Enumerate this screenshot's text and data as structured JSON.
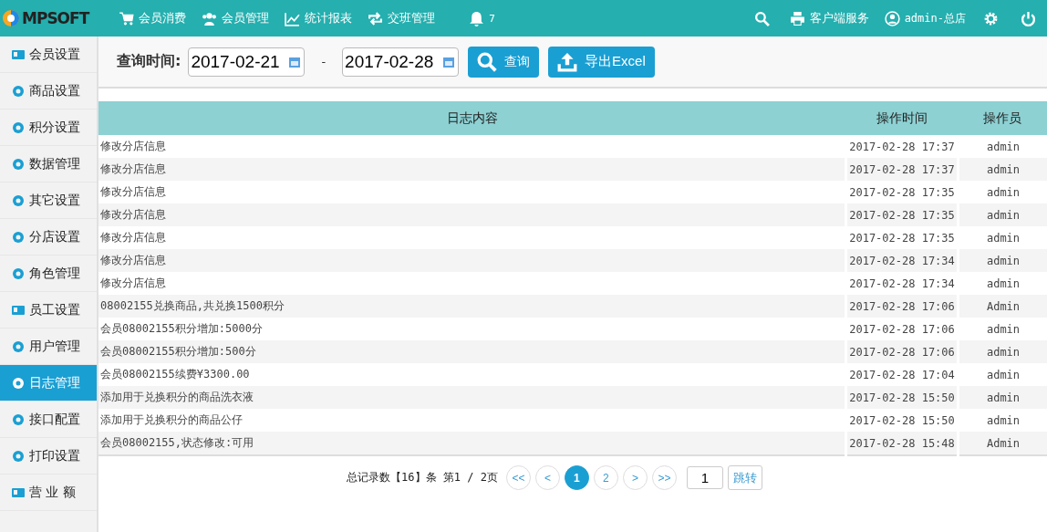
{
  "logo": {
    "text": "MPSOFT"
  },
  "top_nav": [
    {
      "label": "会员消费"
    },
    {
      "label": "会员管理"
    },
    {
      "label": "统计报表"
    },
    {
      "label": "交班管理"
    }
  ],
  "notifications": {
    "count": "7"
  },
  "top_right": {
    "client_service": "客户端服务",
    "user": "admin-总店"
  },
  "sidebar": {
    "items": [
      {
        "label": "会员设置",
        "selected": false
      },
      {
        "label": "商品设置",
        "selected": false
      },
      {
        "label": "积分设置",
        "selected": false
      },
      {
        "label": "数据管理",
        "selected": false
      },
      {
        "label": "其它设置",
        "selected": false
      },
      {
        "label": "分店设置",
        "selected": false
      },
      {
        "label": "角色管理",
        "selected": false
      },
      {
        "label": "员工设置",
        "selected": false
      },
      {
        "label": "用户管理",
        "selected": false
      },
      {
        "label": "日志管理",
        "selected": true
      },
      {
        "label": "接口配置",
        "selected": false
      },
      {
        "label": "打印设置",
        "selected": false
      },
      {
        "label": "营 业 额",
        "selected": false
      }
    ]
  },
  "query": {
    "label": "查询时间:",
    "start": "2017-02-21",
    "separator": "-",
    "end": "2017-02-28",
    "search_button": "查询",
    "export_button": "导出Excel"
  },
  "table": {
    "columns": [
      "日志内容",
      "操作时间",
      "操作员"
    ],
    "rows": [
      [
        "修改分店信息",
        "2017-02-28 17:37",
        "admin"
      ],
      [
        "修改分店信息",
        "2017-02-28 17:37",
        "admin"
      ],
      [
        "修改分店信息",
        "2017-02-28 17:35",
        "admin"
      ],
      [
        "修改分店信息",
        "2017-02-28 17:35",
        "admin"
      ],
      [
        "修改分店信息",
        "2017-02-28 17:35",
        "admin"
      ],
      [
        "修改分店信息",
        "2017-02-28 17:34",
        "admin"
      ],
      [
        "修改分店信息",
        "2017-02-28 17:34",
        "admin"
      ],
      [
        "08002155兑换商品,共兑换1500积分",
        "2017-02-28 17:06",
        "Admin"
      ],
      [
        "会员08002155积分增加:5000分",
        "2017-02-28 17:06",
        "admin"
      ],
      [
        "会员08002155积分增加:500分",
        "2017-02-28 17:06",
        "admin"
      ],
      [
        "会员08002155续费¥3300.00",
        "2017-02-28 17:04",
        "admin"
      ],
      [
        "添加用于兑换积分的商品洗衣液",
        "2017-02-28 15:50",
        "admin"
      ],
      [
        "添加用于兑换积分的商品公仔",
        "2017-02-28 15:50",
        "admin"
      ],
      [
        "会员08002155,状态修改:可用",
        "2017-02-28 15:48",
        "Admin"
      ]
    ]
  },
  "pagination": {
    "summary": "总记录数【16】条 第1 / 2页",
    "first": "<<",
    "prev": "<",
    "pages": [
      {
        "label": "1",
        "selected": true
      },
      {
        "label": "2",
        "selected": false
      }
    ],
    "next": ">",
    "last": ">>",
    "jump_value": "1",
    "jump_button": "跳转"
  }
}
